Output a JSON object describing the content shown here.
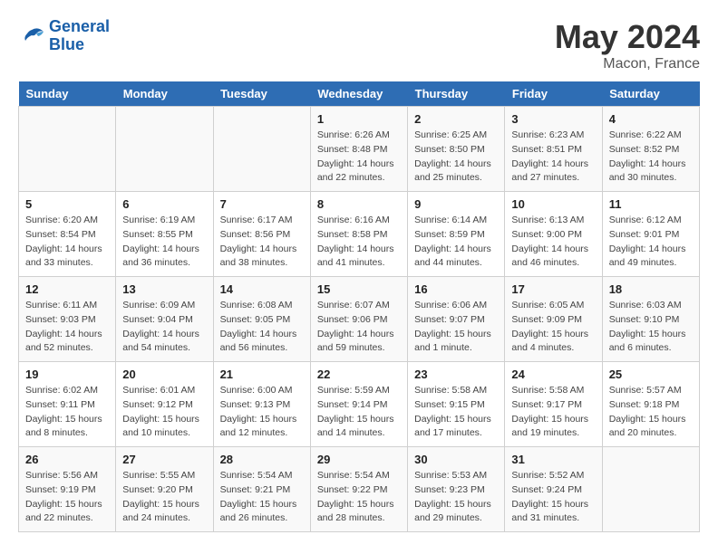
{
  "logo": {
    "text_general": "General",
    "text_blue": "Blue"
  },
  "title": {
    "month_year": "May 2024",
    "location": "Macon, France"
  },
  "weekdays": [
    "Sunday",
    "Monday",
    "Tuesday",
    "Wednesday",
    "Thursday",
    "Friday",
    "Saturday"
  ],
  "weeks": [
    [
      {
        "num": "",
        "sunrise": "",
        "sunset": "",
        "daylight": ""
      },
      {
        "num": "",
        "sunrise": "",
        "sunset": "",
        "daylight": ""
      },
      {
        "num": "",
        "sunrise": "",
        "sunset": "",
        "daylight": ""
      },
      {
        "num": "1",
        "sunrise": "Sunrise: 6:26 AM",
        "sunset": "Sunset: 8:48 PM",
        "daylight": "Daylight: 14 hours and 22 minutes."
      },
      {
        "num": "2",
        "sunrise": "Sunrise: 6:25 AM",
        "sunset": "Sunset: 8:50 PM",
        "daylight": "Daylight: 14 hours and 25 minutes."
      },
      {
        "num": "3",
        "sunrise": "Sunrise: 6:23 AM",
        "sunset": "Sunset: 8:51 PM",
        "daylight": "Daylight: 14 hours and 27 minutes."
      },
      {
        "num": "4",
        "sunrise": "Sunrise: 6:22 AM",
        "sunset": "Sunset: 8:52 PM",
        "daylight": "Daylight: 14 hours and 30 minutes."
      }
    ],
    [
      {
        "num": "5",
        "sunrise": "Sunrise: 6:20 AM",
        "sunset": "Sunset: 8:54 PM",
        "daylight": "Daylight: 14 hours and 33 minutes."
      },
      {
        "num": "6",
        "sunrise": "Sunrise: 6:19 AM",
        "sunset": "Sunset: 8:55 PM",
        "daylight": "Daylight: 14 hours and 36 minutes."
      },
      {
        "num": "7",
        "sunrise": "Sunrise: 6:17 AM",
        "sunset": "Sunset: 8:56 PM",
        "daylight": "Daylight: 14 hours and 38 minutes."
      },
      {
        "num": "8",
        "sunrise": "Sunrise: 6:16 AM",
        "sunset": "Sunset: 8:58 PM",
        "daylight": "Daylight: 14 hours and 41 minutes."
      },
      {
        "num": "9",
        "sunrise": "Sunrise: 6:14 AM",
        "sunset": "Sunset: 8:59 PM",
        "daylight": "Daylight: 14 hours and 44 minutes."
      },
      {
        "num": "10",
        "sunrise": "Sunrise: 6:13 AM",
        "sunset": "Sunset: 9:00 PM",
        "daylight": "Daylight: 14 hours and 46 minutes."
      },
      {
        "num": "11",
        "sunrise": "Sunrise: 6:12 AM",
        "sunset": "Sunset: 9:01 PM",
        "daylight": "Daylight: 14 hours and 49 minutes."
      }
    ],
    [
      {
        "num": "12",
        "sunrise": "Sunrise: 6:11 AM",
        "sunset": "Sunset: 9:03 PM",
        "daylight": "Daylight: 14 hours and 52 minutes."
      },
      {
        "num": "13",
        "sunrise": "Sunrise: 6:09 AM",
        "sunset": "Sunset: 9:04 PM",
        "daylight": "Daylight: 14 hours and 54 minutes."
      },
      {
        "num": "14",
        "sunrise": "Sunrise: 6:08 AM",
        "sunset": "Sunset: 9:05 PM",
        "daylight": "Daylight: 14 hours and 56 minutes."
      },
      {
        "num": "15",
        "sunrise": "Sunrise: 6:07 AM",
        "sunset": "Sunset: 9:06 PM",
        "daylight": "Daylight: 14 hours and 59 minutes."
      },
      {
        "num": "16",
        "sunrise": "Sunrise: 6:06 AM",
        "sunset": "Sunset: 9:07 PM",
        "daylight": "Daylight: 15 hours and 1 minute."
      },
      {
        "num": "17",
        "sunrise": "Sunrise: 6:05 AM",
        "sunset": "Sunset: 9:09 PM",
        "daylight": "Daylight: 15 hours and 4 minutes."
      },
      {
        "num": "18",
        "sunrise": "Sunrise: 6:03 AM",
        "sunset": "Sunset: 9:10 PM",
        "daylight": "Daylight: 15 hours and 6 minutes."
      }
    ],
    [
      {
        "num": "19",
        "sunrise": "Sunrise: 6:02 AM",
        "sunset": "Sunset: 9:11 PM",
        "daylight": "Daylight: 15 hours and 8 minutes."
      },
      {
        "num": "20",
        "sunrise": "Sunrise: 6:01 AM",
        "sunset": "Sunset: 9:12 PM",
        "daylight": "Daylight: 15 hours and 10 minutes."
      },
      {
        "num": "21",
        "sunrise": "Sunrise: 6:00 AM",
        "sunset": "Sunset: 9:13 PM",
        "daylight": "Daylight: 15 hours and 12 minutes."
      },
      {
        "num": "22",
        "sunrise": "Sunrise: 5:59 AM",
        "sunset": "Sunset: 9:14 PM",
        "daylight": "Daylight: 15 hours and 14 minutes."
      },
      {
        "num": "23",
        "sunrise": "Sunrise: 5:58 AM",
        "sunset": "Sunset: 9:15 PM",
        "daylight": "Daylight: 15 hours and 17 minutes."
      },
      {
        "num": "24",
        "sunrise": "Sunrise: 5:58 AM",
        "sunset": "Sunset: 9:17 PM",
        "daylight": "Daylight: 15 hours and 19 minutes."
      },
      {
        "num": "25",
        "sunrise": "Sunrise: 5:57 AM",
        "sunset": "Sunset: 9:18 PM",
        "daylight": "Daylight: 15 hours and 20 minutes."
      }
    ],
    [
      {
        "num": "26",
        "sunrise": "Sunrise: 5:56 AM",
        "sunset": "Sunset: 9:19 PM",
        "daylight": "Daylight: 15 hours and 22 minutes."
      },
      {
        "num": "27",
        "sunrise": "Sunrise: 5:55 AM",
        "sunset": "Sunset: 9:20 PM",
        "daylight": "Daylight: 15 hours and 24 minutes."
      },
      {
        "num": "28",
        "sunrise": "Sunrise: 5:54 AM",
        "sunset": "Sunset: 9:21 PM",
        "daylight": "Daylight: 15 hours and 26 minutes."
      },
      {
        "num": "29",
        "sunrise": "Sunrise: 5:54 AM",
        "sunset": "Sunset: 9:22 PM",
        "daylight": "Daylight: 15 hours and 28 minutes."
      },
      {
        "num": "30",
        "sunrise": "Sunrise: 5:53 AM",
        "sunset": "Sunset: 9:23 PM",
        "daylight": "Daylight: 15 hours and 29 minutes."
      },
      {
        "num": "31",
        "sunrise": "Sunrise: 5:52 AM",
        "sunset": "Sunset: 9:24 PM",
        "daylight": "Daylight: 15 hours and 31 minutes."
      },
      {
        "num": "",
        "sunrise": "",
        "sunset": "",
        "daylight": ""
      }
    ]
  ]
}
